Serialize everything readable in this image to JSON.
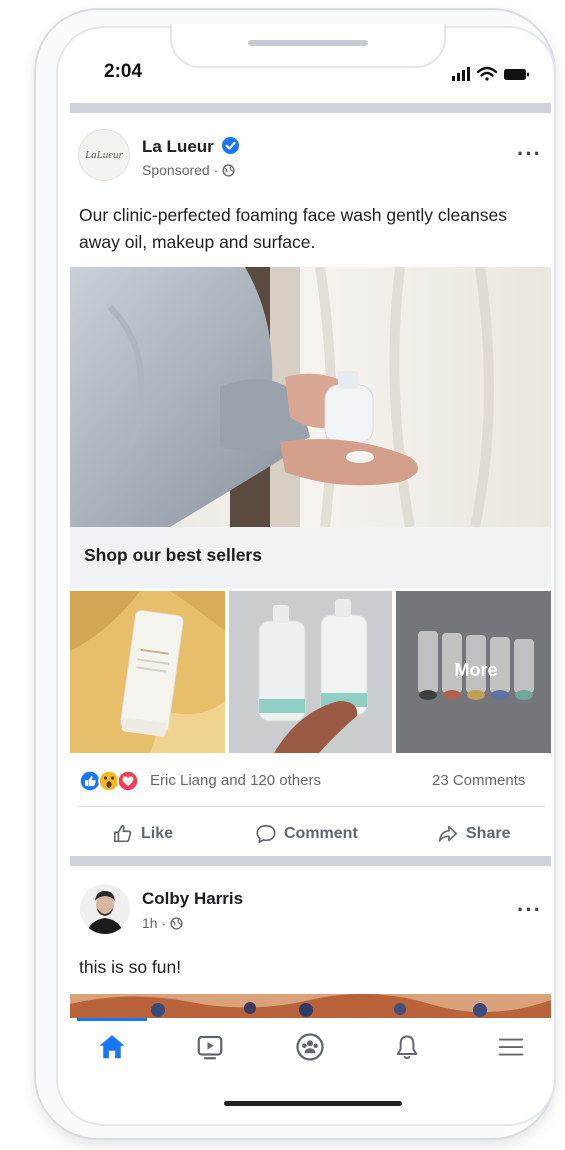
{
  "status_bar": {
    "time": "2:04"
  },
  "post1": {
    "page_name": "La Lueur",
    "brand_logo_text": "LaLueur",
    "sponsored_label": "Sponsored",
    "body": "Our clinic-perfected foaming face wash gently cleanses away oil, makeup and surface.",
    "shop_label": "Shop our best sellers",
    "product_tile_3_label": "More",
    "reactions_text": "Eric Liang and 120 others",
    "comments_count": "23 Comments",
    "actions": {
      "like": "Like",
      "comment": "Comment",
      "share": "Share"
    },
    "verified_badge_color": "#1877f2"
  },
  "post2": {
    "author": "Colby Harris",
    "time": "1h",
    "body": "this is so fun!"
  },
  "tab_bar": {
    "items": [
      "home-icon",
      "watch-icon",
      "groups-icon",
      "notifications-icon",
      "menu-icon"
    ],
    "active": "home-icon",
    "accent_color": "#1877f2"
  }
}
